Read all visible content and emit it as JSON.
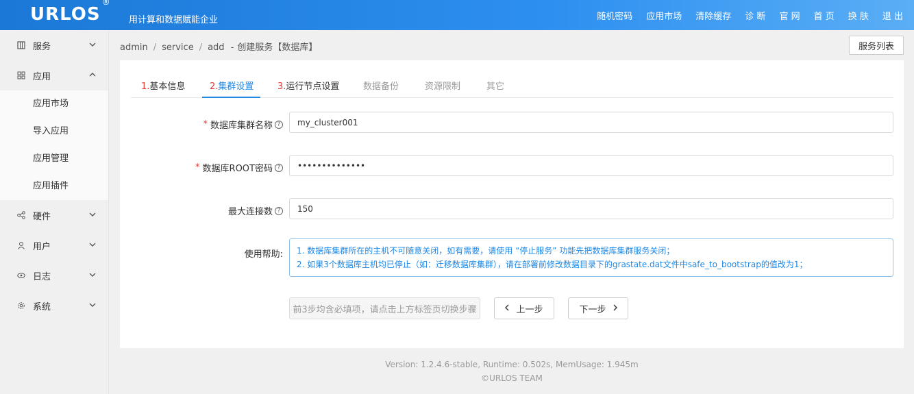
{
  "header": {
    "logo": "URLOS",
    "logo_mark": "®",
    "slogan": "用计算和数据赋能企业",
    "nav": [
      "随机密码",
      "应用市场",
      "清除缓存",
      "诊 断",
      "官 网",
      "首 页",
      "换 肤",
      "退 出"
    ]
  },
  "sidebar": {
    "items": [
      {
        "label": "服务",
        "icon": "grid-icon",
        "expanded": false
      },
      {
        "label": "应用",
        "icon": "apps-icon",
        "expanded": true,
        "children": [
          "应用市场",
          "导入应用",
          "应用管理",
          "应用插件"
        ]
      },
      {
        "label": "硬件",
        "icon": "share-icon",
        "expanded": false
      },
      {
        "label": "用户",
        "icon": "user-icon",
        "expanded": false
      },
      {
        "label": "日志",
        "icon": "eye-icon",
        "expanded": false
      },
      {
        "label": "系统",
        "icon": "gear-icon",
        "expanded": false
      }
    ]
  },
  "breadcrumb": {
    "parts": [
      "admin",
      "service",
      "add"
    ],
    "dash": "-",
    "current": "创建服务【数据库】"
  },
  "service_list_button": "服务列表",
  "tabs": [
    {
      "num": "1.",
      "label": "基本信息",
      "state": "normal"
    },
    {
      "num": "2.",
      "label": "集群设置",
      "state": "active"
    },
    {
      "num": "3.",
      "label": "运行节点设置",
      "state": "normal"
    },
    {
      "num": "",
      "label": "数据备份",
      "state": "disabled"
    },
    {
      "num": "",
      "label": "资源限制",
      "state": "disabled"
    },
    {
      "num": "",
      "label": "其它",
      "state": "disabled"
    }
  ],
  "form": {
    "cluster_name": {
      "label": "数据库集群名称",
      "required": "*",
      "value": "my_cluster001"
    },
    "root_password": {
      "label": "数据库ROOT密码",
      "required": "*",
      "value": "••••••••••••••"
    },
    "max_conn": {
      "label": "最大连接数",
      "value": "150"
    },
    "help": {
      "label": "使用帮助:",
      "lines": [
        "1. 数据库集群所在的主机不可随意关闭，如有需要，请使用 “停止服务” 功能先把数据库集群服务关闭；",
        "2. 如果3个数据库主机均已停止（如：迁移数据库集群），请在部署前修改数据目录下的grastate.dat文件中safe_to_bootstrap的值改为1；"
      ]
    }
  },
  "buttons": {
    "hint": "前3步均含必填项，请点击上方标签页切换步骤",
    "prev": "上一步",
    "next": "下一步"
  },
  "footer": {
    "line1": "Version: 1.2.4.6-stable,   Runtime: 0.502s,   MemUsage: 1.945m",
    "line2": "©URLOS TEAM"
  },
  "colors": {
    "header_blue": "#2d8ff0",
    "accent": "#1e88e5",
    "required_red": "#e53935"
  }
}
